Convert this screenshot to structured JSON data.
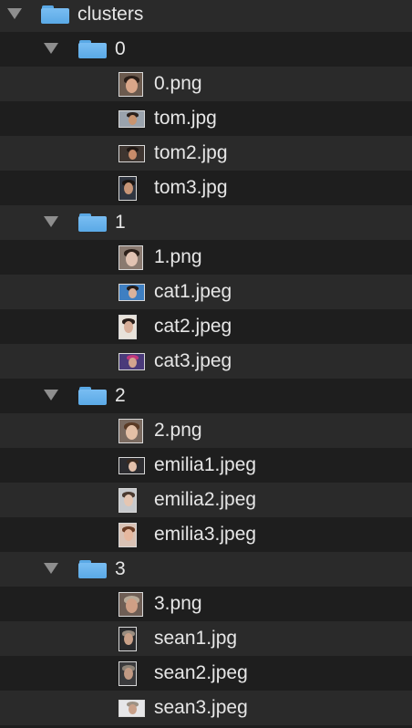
{
  "tree": {
    "root": {
      "name": "clusters",
      "expanded": true
    },
    "clusters": [
      {
        "name": "0",
        "files": [
          {
            "name": "0.png",
            "thumb": {
              "shape": "square",
              "bg": "#6b5a4e",
              "face": "#d9a689",
              "hair": "#2a1e18"
            }
          },
          {
            "name": "tom.jpg",
            "thumb": {
              "shape": "wide",
              "bg": "#9aa3ad",
              "face": "#c9946f",
              "hair": "#2b211c"
            }
          },
          {
            "name": "tom2.jpg",
            "thumb": {
              "shape": "wide",
              "bg": "#3e3530",
              "face": "#c98c6a",
              "hair": "#1f1713"
            }
          },
          {
            "name": "tom3.jpg",
            "thumb": {
              "shape": "tall",
              "bg": "#2f3540",
              "face": "#c79577",
              "hair": "#1b1512"
            }
          }
        ]
      },
      {
        "name": "1",
        "files": [
          {
            "name": "1.png",
            "thumb": {
              "shape": "square",
              "bg": "#8a7a70",
              "face": "#e2c3b3",
              "hair": "#2e211b"
            }
          },
          {
            "name": "cat1.jpeg",
            "thumb": {
              "shape": "wide",
              "bg": "#3e7fc2",
              "face": "#d9b29c",
              "hair": "#241a16"
            }
          },
          {
            "name": "cat2.jpeg",
            "thumb": {
              "shape": "tall",
              "bg": "#e8e2da",
              "face": "#d8ae98",
              "hair": "#2a1e19"
            }
          },
          {
            "name": "cat3.jpeg",
            "thumb": {
              "shape": "wide",
              "bg": "#4a3a7a",
              "face": "#d2a48f",
              "hair": "#c2387c"
            }
          }
        ]
      },
      {
        "name": "2",
        "files": [
          {
            "name": "2.png",
            "thumb": {
              "shape": "square",
              "bg": "#7a6a60",
              "face": "#e3bfa6",
              "hair": "#5a3a25"
            }
          },
          {
            "name": "emilia1.jpeg",
            "thumb": {
              "shape": "wide",
              "bg": "#2c2c30",
              "face": "#e4c1ab",
              "hair": "#3a2a20"
            }
          },
          {
            "name": "emilia2.jpeg",
            "thumb": {
              "shape": "tall",
              "bg": "#c7c9cc",
              "face": "#e5c6b2",
              "hair": "#4a3a30"
            }
          },
          {
            "name": "emilia3.jpeg",
            "thumb": {
              "shape": "tall",
              "bg": "#d9c2b5",
              "face": "#e6b89f",
              "hair": "#6a3c24"
            }
          }
        ]
      },
      {
        "name": "3",
        "files": [
          {
            "name": "3.png",
            "thumb": {
              "shape": "square",
              "bg": "#6e5e55",
              "face": "#cf9f85",
              "hair": "#b8aa98"
            }
          },
          {
            "name": "sean1.jpg",
            "thumb": {
              "shape": "tall",
              "bg": "#2a2a2c",
              "face": "#c9a088",
              "hair": "#9a8d80"
            }
          },
          {
            "name": "sean2.jpeg",
            "thumb": {
              "shape": "tall",
              "bg": "#3a3a3c",
              "face": "#c29a84",
              "hair": "#8e8478"
            }
          },
          {
            "name": "sean3.jpeg",
            "thumb": {
              "shape": "wide",
              "bg": "#e6e6e8",
              "face": "#c8a089",
              "hair": "#9c9184"
            }
          }
        ]
      }
    ]
  },
  "colors": {
    "background": "#1e1e1e",
    "row_alternate": "#2a2a2a",
    "text": "#e6e6e6",
    "disclosure": "#8e8e8e",
    "folder": "#5aa9e6"
  },
  "icons": {
    "disclosure": "disclosure-triangle-icon",
    "folder": "folder-icon",
    "image": "image-thumbnail-icon"
  }
}
